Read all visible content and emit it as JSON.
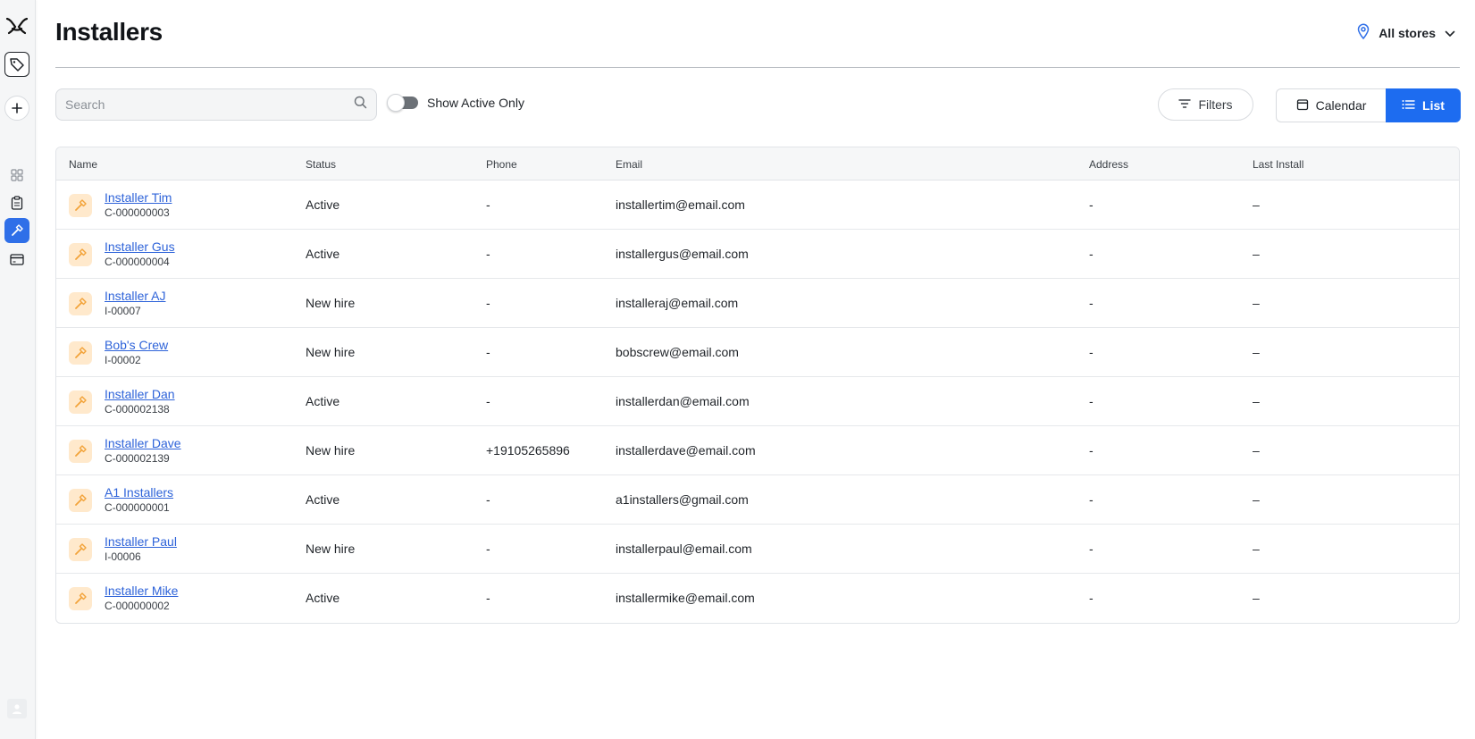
{
  "header": {
    "title": "Installers",
    "store_picker": "All stores"
  },
  "toolbar": {
    "search_placeholder": "Search",
    "search_value": "",
    "toggle_label": "Show Active Only",
    "filters_label": "Filters",
    "calendar_label": "Calendar",
    "list_label": "List"
  },
  "table": {
    "columns": {
      "name": "Name",
      "status": "Status",
      "phone": "Phone",
      "email": "Email",
      "address": "Address",
      "last_install": "Last Install"
    },
    "rows": [
      {
        "name": "Installer Tim",
        "id": "C-000000003",
        "status": "Active",
        "phone": "-",
        "email": "installertim@email.com",
        "address": "-",
        "last_install": "–"
      },
      {
        "name": "Installer Gus",
        "id": "C-000000004",
        "status": "Active",
        "phone": "-",
        "email": "installergus@email.com",
        "address": "-",
        "last_install": "–"
      },
      {
        "name": "Installer AJ",
        "id": "I-00007",
        "status": "New hire",
        "phone": "-",
        "email": "installeraj@email.com",
        "address": "-",
        "last_install": "–"
      },
      {
        "name": "Bob's Crew",
        "id": "I-00002",
        "status": "New hire",
        "phone": "-",
        "email": "bobscrew@email.com",
        "address": "-",
        "last_install": "–"
      },
      {
        "name": "Installer Dan",
        "id": "C-000002138",
        "status": "Active",
        "phone": "-",
        "email": "installerdan@email.com",
        "address": "-",
        "last_install": "–"
      },
      {
        "name": "Installer Dave",
        "id": "C-000002139",
        "status": "New hire",
        "phone": "+19105265896",
        "email": "installerdave@email.com",
        "address": "-",
        "last_install": "–"
      },
      {
        "name": "A1 Installers",
        "id": "C-000000001",
        "status": "Active",
        "phone": "-",
        "email": "a1installers@gmail.com",
        "address": "-",
        "last_install": "–"
      },
      {
        "name": "Installer Paul",
        "id": "I-00006",
        "status": "New hire",
        "phone": "-",
        "email": "installerpaul@email.com",
        "address": "-",
        "last_install": "–"
      },
      {
        "name": "Installer Mike",
        "id": "C-000000002",
        "status": "Active",
        "phone": "-",
        "email": "installermike@email.com",
        "address": "-",
        "last_install": "–"
      }
    ]
  },
  "icons": {
    "logo": "brand-logo-icon",
    "tag": "tag-icon",
    "add": "plus-icon",
    "grid": "grid-icon",
    "clipboard": "clipboard-icon",
    "hammer": "hammer-icon",
    "card": "credit-card-icon",
    "location": "map-pin-icon",
    "chevron": "chevron-down-icon",
    "search": "search-icon",
    "filter": "filter-icon",
    "calendar": "calendar-icon",
    "list": "list-icon"
  },
  "colors": {
    "accent": "#1d6cf0",
    "link": "#2e63d9",
    "avatar_bg": "#ffe9cc",
    "avatar_icon": "#f2a33a"
  }
}
